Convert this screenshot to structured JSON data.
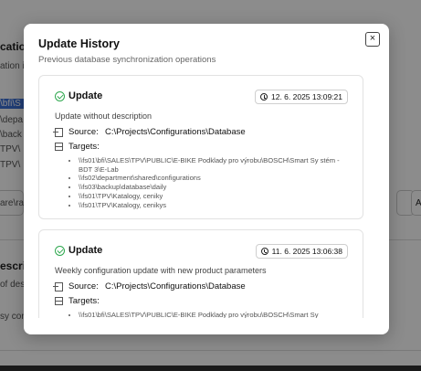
{
  "background": {
    "fragments": [
      "cation",
      "ation i",
      "\\bfi\\S",
      "\\depa",
      "\\back",
      "TPV\\",
      "TPV\\",
      "are\\ra",
      "escrip",
      "of desc",
      "sy conf",
      "A"
    ]
  },
  "modal": {
    "title": "Update History",
    "subtitle": "Previous database synchronization operations",
    "close_symbol": "×",
    "entries": [
      {
        "type": "Update",
        "timestamp": "12. 6. 2025 13:09:21",
        "description": "Update without description",
        "source_label": "Source:",
        "source_value": "C:\\Projects\\Configurations\\Database",
        "targets_label": "Targets:",
        "targets": [
          "\\\\fs01\\bfi\\SALES\\TPV\\PUBLIC\\E-BIKE Podklady pro výrobu\\BOSCH\\Smart Sy stém - BDT 3\\E-Lab",
          "\\\\fs02\\department\\shared\\configurations",
          "\\\\fs03\\backup\\database\\daily",
          "\\\\fs01\\TPV\\Katalogy, ceniky",
          "\\\\fs01\\TPV\\Katalogy, cenikys"
        ]
      },
      {
        "type": "Update",
        "timestamp": "11. 6. 2025 13:06:38",
        "description": "Weekly configuration update with new product parameters",
        "source_label": "Source:",
        "source_value": "C:\\Projects\\Configurations\\Database",
        "targets_label": "Targets:",
        "targets": [
          "\\\\fs01\\bfi\\SALES\\TPV\\PUBLIC\\E-BIKE Podklady pro výrobu\\BOSCH\\Smart Sy"
        ]
      }
    ]
  },
  "colors": {
    "success": "#2fa84f",
    "overlay": "rgba(0,0,0,0.45)",
    "selection": "#3b6fd6"
  }
}
